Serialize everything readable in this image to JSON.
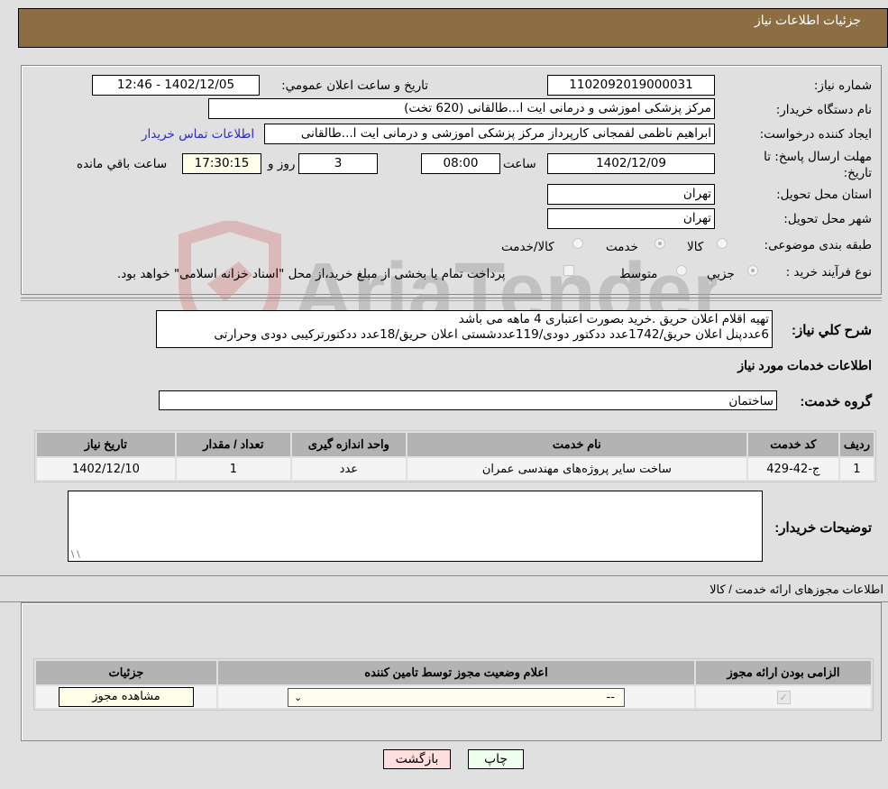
{
  "header": {
    "title": "جزئیات اطلاعات نیاز"
  },
  "form": {
    "need_number": {
      "label": "شماره نیاز:",
      "value": "1102092019000031"
    },
    "announce_datetime": {
      "label": "تاریخ و ساعت اعلان عمومي:",
      "value": "1402/12/05 - 12:46"
    },
    "buyer_org": {
      "label": "نام دستگاه خریدار:",
      "value": "مرکز پزشکی  اموزشی و درمانی ایت ا...طالقانی (620 تخت)"
    },
    "requester": {
      "label": "ایجاد کننده درخواست:",
      "value": "ابراهیم ناظمی لفمجانی کارپرداز مرکز پزشکی  اموزشی و درمانی ایت ا...طالقانی"
    },
    "buyer_contact_link": "اطلاعات تماس خریدار",
    "deadline": {
      "label_line1": "مهلت ارسال پاسخ: تا",
      "label_line2": "تاریخ:",
      "date": "1402/12/09",
      "time_label": "ساعت",
      "time": "08:00",
      "days": "3",
      "days_label": "روز و",
      "remaining": "17:30:15",
      "remaining_label": "ساعت باقي مانده"
    },
    "province": {
      "label": "استان محل تحویل:",
      "value": "تهران"
    },
    "city": {
      "label": "شهر محل تحویل:",
      "value": "تهران"
    },
    "category": {
      "label": "طبقه بندی موضوعی:",
      "options": [
        "کالا",
        "خدمت",
        "کالا/خدمت"
      ],
      "selected": "خدمت"
    },
    "purchase_type": {
      "label": "نوع فرآیند خرید :",
      "options": [
        "جزيي",
        "متوسط"
      ],
      "selected": "جزيي",
      "treasury_note": "پرداخت تمام یا بخشی از مبلغ خرید،از محل \"اسناد خزانه اسلامی\" خواهد بود."
    }
  },
  "description": {
    "label": "شرح کلي نياز:",
    "line1": "تهیه اقلام اعلان حریق .خرید بصورت اعتباری 4 ماهه می باشد",
    "line2": "6عددپنل اعلان حریق/1742عدد ددکتور دودی/119عددشستی اعلان حریق/18عدد ددکتورترکیبی دودی وحرارتی"
  },
  "services": {
    "section_title": "اطلاعات خدمات مورد نیاز",
    "group_label": "گروه خدمت:",
    "group_value": "ساختمان",
    "columns": [
      "ردیف",
      "کد خدمت",
      "نام خدمت",
      "واحد اندازه گیری",
      "تعداد / مقدار",
      "تاریخ نیاز"
    ],
    "rows": [
      [
        "1",
        "ج-42-429",
        "ساخت سایر پروژه‌های مهندسی عمران",
        "عدد",
        "1",
        "1402/12/10"
      ]
    ]
  },
  "buyer_notes": {
    "label": "توضیحات خریدار:",
    "value": ""
  },
  "permits": {
    "section_title": "اطلاعات مجوزهای ارائه خدمت / کالا",
    "columns": [
      "الزامی بودن ارائه مجوز",
      "اعلام وضعیت مجوز توسط تامین کننده",
      "جزئیات"
    ],
    "row": {
      "required_checked": true,
      "status_value": "--",
      "details_button": "مشاهده مجوز"
    }
  },
  "footer": {
    "print_label": "چاپ",
    "back_label": "بازگشت"
  },
  "watermark": {
    "text": "AriaTender.neT"
  },
  "colors": {
    "header_bg": "#8d6e43",
    "link": "#2a2ad0",
    "print_bg": "#eeffee",
    "back_bg": "#ffdede"
  }
}
